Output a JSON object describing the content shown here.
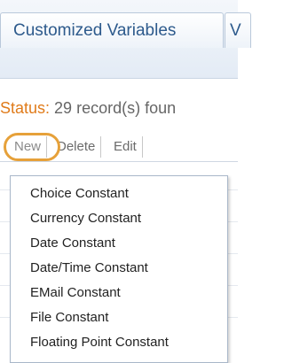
{
  "tabs": {
    "active_label": "Customized Variables",
    "next_label": "V"
  },
  "status": {
    "label": "Status:",
    "text": "29 record(s) foun"
  },
  "toolbar": {
    "new_label": "New",
    "delete_label": "Delete",
    "edit_label": "Edit"
  },
  "menu": {
    "items": [
      {
        "label": "Choice Constant"
      },
      {
        "label": "Currency Constant"
      },
      {
        "label": "Date Constant"
      },
      {
        "label": "Date/Time Constant"
      },
      {
        "label": "EMail Constant"
      },
      {
        "label": "File Constant"
      },
      {
        "label": "Floating Point Constant"
      }
    ]
  },
  "colors": {
    "tab_text": "#2d5a8c",
    "status_label": "#e07b1a",
    "highlight_ring": "#e6a13a"
  }
}
